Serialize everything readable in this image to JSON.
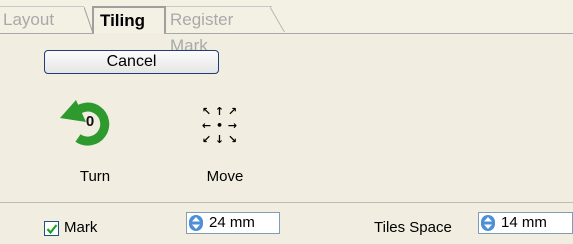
{
  "tabs": [
    {
      "label": "Layout",
      "active": false
    },
    {
      "label": "Tiling",
      "active": true
    },
    {
      "label": "Register Mark",
      "active": false
    }
  ],
  "cancel_label": "Cancel",
  "turn": {
    "label": "Turn",
    "value": "0",
    "icon": "rotate-ccw-icon",
    "icon_color": "#2e9a2e"
  },
  "move": {
    "label": "Move",
    "icon": "move-arrows-icon",
    "arrows": [
      "↖",
      "↑",
      "↗",
      "←",
      "•",
      "→",
      "↙",
      "↓",
      "↘"
    ]
  },
  "mark": {
    "label": "Mark",
    "checked": true,
    "value": "24 mm"
  },
  "tiles_space": {
    "label": "Tiles Space",
    "value": "14 mm"
  },
  "colors": {
    "background": "#f1eee1",
    "accent": "#4f8fd6",
    "button_border": "#1f3f7a"
  }
}
